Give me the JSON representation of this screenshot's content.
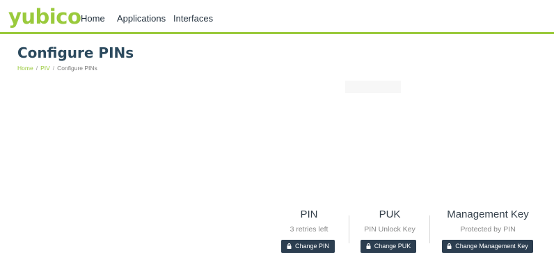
{
  "header": {
    "logo": "yubico",
    "nav": [
      {
        "label": "Home"
      },
      {
        "label": "Applications"
      },
      {
        "label": "Interfaces"
      }
    ]
  },
  "page": {
    "title": "Configure PINs",
    "breadcrumb": [
      "Home",
      "PIV",
      "Configure PINs"
    ],
    "separator": "/"
  },
  "pins": [
    {
      "title": "PIN",
      "subtitle": "3 retries left",
      "button": "Change PIN",
      "icon": "lock-icon"
    },
    {
      "title": "PUK",
      "subtitle": "PIN Unlock Key",
      "button": "Change PUK",
      "icon": "lock-icon"
    },
    {
      "title": "Management Key",
      "subtitle": "Protected by PIN",
      "button": "Change Management Key",
      "icon": "lock-icon"
    }
  ],
  "colors": {
    "brand_green": "#9aca3c",
    "button_dark": "#2c3e50",
    "title_blue": "#2c4a5e"
  }
}
